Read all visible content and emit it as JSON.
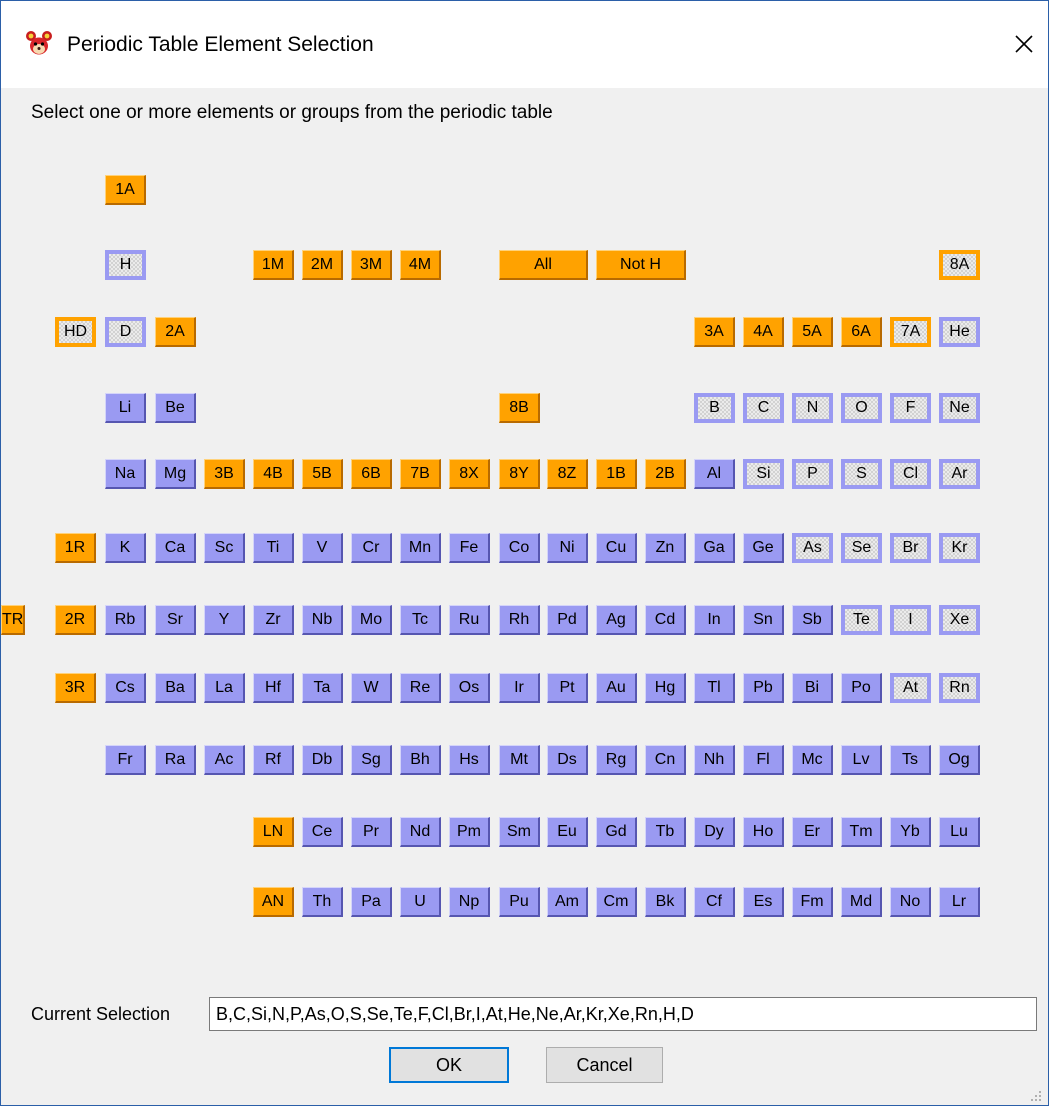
{
  "window": {
    "title": "Periodic Table Element Selection",
    "app_icon": "mouse-face-icon",
    "close_icon": "close-icon"
  },
  "instructions": "Select one or more elements or groups from the periodic table",
  "colors": {
    "element": "#9a9af2",
    "group": "#ffa200",
    "selected_fill": "#ebebeb",
    "ok_focus": "#0078d7"
  },
  "rows": [
    {
      "cells": [
        {
          "label": "1A",
          "kind": "group"
        }
      ]
    },
    {
      "cells": [
        {
          "label": "H",
          "kind": "element",
          "selected": true
        },
        {
          "label": "1M",
          "kind": "group"
        },
        {
          "label": "2M",
          "kind": "group"
        },
        {
          "label": "3M",
          "kind": "group"
        },
        {
          "label": "4M",
          "kind": "group"
        },
        {
          "label": "All",
          "kind": "group"
        },
        {
          "label": "Not H",
          "kind": "group"
        },
        {
          "label": "8A",
          "kind": "group",
          "selected": true
        }
      ]
    },
    {
      "cells": [
        {
          "label": "HD",
          "kind": "group",
          "selected": true
        },
        {
          "label": "D",
          "kind": "element",
          "selected": true
        },
        {
          "label": "2A",
          "kind": "group"
        },
        {
          "label": "3A",
          "kind": "group"
        },
        {
          "label": "4A",
          "kind": "group"
        },
        {
          "label": "5A",
          "kind": "group"
        },
        {
          "label": "6A",
          "kind": "group"
        },
        {
          "label": "7A",
          "kind": "group",
          "selected": true
        },
        {
          "label": "He",
          "kind": "element",
          "selected": true
        }
      ]
    },
    {
      "cells": [
        {
          "label": "Li",
          "kind": "element"
        },
        {
          "label": "Be",
          "kind": "element"
        },
        {
          "label": "8B",
          "kind": "group"
        },
        {
          "label": "B",
          "kind": "element",
          "selected": true
        },
        {
          "label": "C",
          "kind": "element",
          "selected": true
        },
        {
          "label": "N",
          "kind": "element",
          "selected": true
        },
        {
          "label": "O",
          "kind": "element",
          "selected": true
        },
        {
          "label": "F",
          "kind": "element",
          "selected": true
        },
        {
          "label": "Ne",
          "kind": "element",
          "selected": true
        }
      ]
    },
    {
      "cells": [
        {
          "label": "Na",
          "kind": "element"
        },
        {
          "label": "Mg",
          "kind": "element"
        },
        {
          "label": "3B",
          "kind": "group"
        },
        {
          "label": "4B",
          "kind": "group"
        },
        {
          "label": "5B",
          "kind": "group"
        },
        {
          "label": "6B",
          "kind": "group"
        },
        {
          "label": "7B",
          "kind": "group"
        },
        {
          "label": "8X",
          "kind": "group"
        },
        {
          "label": "8Y",
          "kind": "group"
        },
        {
          "label": "8Z",
          "kind": "group"
        },
        {
          "label": "1B",
          "kind": "group"
        },
        {
          "label": "2B",
          "kind": "group"
        },
        {
          "label": "Al",
          "kind": "element"
        },
        {
          "label": "Si",
          "kind": "element",
          "selected": true
        },
        {
          "label": "P",
          "kind": "element",
          "selected": true
        },
        {
          "label": "S",
          "kind": "element",
          "selected": true
        },
        {
          "label": "Cl",
          "kind": "element",
          "selected": true
        },
        {
          "label": "Ar",
          "kind": "element",
          "selected": true
        }
      ]
    },
    {
      "cells": [
        {
          "label": "1R",
          "kind": "group"
        },
        {
          "label": "K",
          "kind": "element"
        },
        {
          "label": "Ca",
          "kind": "element"
        },
        {
          "label": "Sc",
          "kind": "element"
        },
        {
          "label": "Ti",
          "kind": "element"
        },
        {
          "label": "V",
          "kind": "element"
        },
        {
          "label": "Cr",
          "kind": "element"
        },
        {
          "label": "Mn",
          "kind": "element"
        },
        {
          "label": "Fe",
          "kind": "element"
        },
        {
          "label": "Co",
          "kind": "element"
        },
        {
          "label": "Ni",
          "kind": "element"
        },
        {
          "label": "Cu",
          "kind": "element"
        },
        {
          "label": "Zn",
          "kind": "element"
        },
        {
          "label": "Ga",
          "kind": "element"
        },
        {
          "label": "Ge",
          "kind": "element"
        },
        {
          "label": "As",
          "kind": "element",
          "selected": true
        },
        {
          "label": "Se",
          "kind": "element",
          "selected": true
        },
        {
          "label": "Br",
          "kind": "element",
          "selected": true
        },
        {
          "label": "Kr",
          "kind": "element",
          "selected": true
        }
      ]
    },
    {
      "cells": [
        {
          "label": "TR",
          "kind": "group"
        },
        {
          "label": "2R",
          "kind": "group"
        },
        {
          "label": "Rb",
          "kind": "element"
        },
        {
          "label": "Sr",
          "kind": "element"
        },
        {
          "label": "Y",
          "kind": "element"
        },
        {
          "label": "Zr",
          "kind": "element"
        },
        {
          "label": "Nb",
          "kind": "element"
        },
        {
          "label": "Mo",
          "kind": "element"
        },
        {
          "label": "Tc",
          "kind": "element"
        },
        {
          "label": "Ru",
          "kind": "element"
        },
        {
          "label": "Rh",
          "kind": "element"
        },
        {
          "label": "Pd",
          "kind": "element"
        },
        {
          "label": "Ag",
          "kind": "element"
        },
        {
          "label": "Cd",
          "kind": "element"
        },
        {
          "label": "In",
          "kind": "element"
        },
        {
          "label": "Sn",
          "kind": "element"
        },
        {
          "label": "Sb",
          "kind": "element"
        },
        {
          "label": "Te",
          "kind": "element",
          "selected": true
        },
        {
          "label": "I",
          "kind": "element",
          "selected": true
        },
        {
          "label": "Xe",
          "kind": "element",
          "selected": true
        }
      ]
    },
    {
      "cells": [
        {
          "label": "3R",
          "kind": "group"
        },
        {
          "label": "Cs",
          "kind": "element"
        },
        {
          "label": "Ba",
          "kind": "element"
        },
        {
          "label": "La",
          "kind": "element"
        },
        {
          "label": "Hf",
          "kind": "element"
        },
        {
          "label": "Ta",
          "kind": "element"
        },
        {
          "label": "W",
          "kind": "element"
        },
        {
          "label": "Re",
          "kind": "element"
        },
        {
          "label": "Os",
          "kind": "element"
        },
        {
          "label": "Ir",
          "kind": "element"
        },
        {
          "label": "Pt",
          "kind": "element"
        },
        {
          "label": "Au",
          "kind": "element"
        },
        {
          "label": "Hg",
          "kind": "element"
        },
        {
          "label": "Tl",
          "kind": "element"
        },
        {
          "label": "Pb",
          "kind": "element"
        },
        {
          "label": "Bi",
          "kind": "element"
        },
        {
          "label": "Po",
          "kind": "element"
        },
        {
          "label": "At",
          "kind": "element",
          "selected": true
        },
        {
          "label": "Rn",
          "kind": "element",
          "selected": true
        }
      ]
    },
    {
      "cells": [
        {
          "label": "Fr",
          "kind": "element"
        },
        {
          "label": "Ra",
          "kind": "element"
        },
        {
          "label": "Ac",
          "kind": "element"
        },
        {
          "label": "Rf",
          "kind": "element"
        },
        {
          "label": "Db",
          "kind": "element"
        },
        {
          "label": "Sg",
          "kind": "element"
        },
        {
          "label": "Bh",
          "kind": "element"
        },
        {
          "label": "Hs",
          "kind": "element"
        },
        {
          "label": "Mt",
          "kind": "element"
        },
        {
          "label": "Ds",
          "kind": "element"
        },
        {
          "label": "Rg",
          "kind": "element"
        },
        {
          "label": "Cn",
          "kind": "element"
        },
        {
          "label": "Nh",
          "kind": "element"
        },
        {
          "label": "Fl",
          "kind": "element"
        },
        {
          "label": "Mc",
          "kind": "element"
        },
        {
          "label": "Lv",
          "kind": "element"
        },
        {
          "label": "Ts",
          "kind": "element"
        },
        {
          "label": "Og",
          "kind": "element"
        }
      ]
    },
    {
      "cells": [
        {
          "label": "LN",
          "kind": "group"
        },
        {
          "label": "Ce",
          "kind": "element"
        },
        {
          "label": "Pr",
          "kind": "element"
        },
        {
          "label": "Nd",
          "kind": "element"
        },
        {
          "label": "Pm",
          "kind": "element"
        },
        {
          "label": "Sm",
          "kind": "element"
        },
        {
          "label": "Eu",
          "kind": "element"
        },
        {
          "label": "Gd",
          "kind": "element"
        },
        {
          "label": "Tb",
          "kind": "element"
        },
        {
          "label": "Dy",
          "kind": "element"
        },
        {
          "label": "Ho",
          "kind": "element"
        },
        {
          "label": "Er",
          "kind": "element"
        },
        {
          "label": "Tm",
          "kind": "element"
        },
        {
          "label": "Yb",
          "kind": "element"
        },
        {
          "label": "Lu",
          "kind": "element"
        }
      ]
    },
    {
      "cells": [
        {
          "label": "AN",
          "kind": "group"
        },
        {
          "label": "Th",
          "kind": "element"
        },
        {
          "label": "Pa",
          "kind": "element"
        },
        {
          "label": "U",
          "kind": "element"
        },
        {
          "label": "Np",
          "kind": "element"
        },
        {
          "label": "Pu",
          "kind": "element"
        },
        {
          "label": "Am",
          "kind": "element"
        },
        {
          "label": "Cm",
          "kind": "element"
        },
        {
          "label": "Bk",
          "kind": "element"
        },
        {
          "label": "Cf",
          "kind": "element"
        },
        {
          "label": "Es",
          "kind": "element"
        },
        {
          "label": "Fm",
          "kind": "element"
        },
        {
          "label": "Md",
          "kind": "element"
        },
        {
          "label": "No",
          "kind": "element"
        },
        {
          "label": "Lr",
          "kind": "element"
        }
      ]
    }
  ],
  "current_selection": {
    "label": "Current Selection",
    "value": "B,C,Si,N,P,As,O,S,Se,Te,F,Cl,Br,I,At,He,Ne,Ar,Kr,Xe,Rn,H,D"
  },
  "buttons": {
    "ok": "OK",
    "cancel": "Cancel"
  }
}
